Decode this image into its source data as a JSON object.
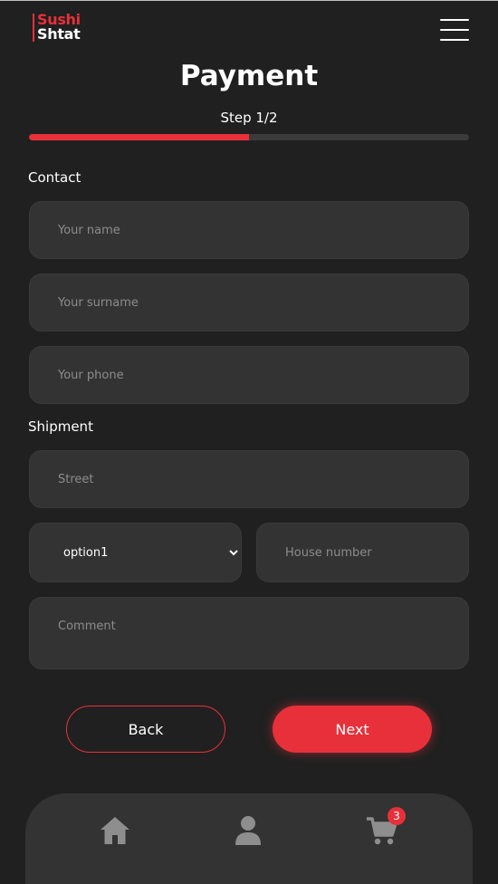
{
  "header": {
    "logo_line1": "Sushi",
    "logo_line2": "Shtat",
    "menu_icon": "hamburger-menu-icon"
  },
  "page": {
    "title": "Payment",
    "step_label": "Step 1/2",
    "progress_fraction": 0.5
  },
  "contact": {
    "section_title": "Contact",
    "name_placeholder": "Your name",
    "surname_placeholder": "Your surname",
    "phone_placeholder": "Your phone"
  },
  "shipment": {
    "section_title": "Shipment",
    "street_placeholder": "Street",
    "select_value": "option1",
    "house_placeholder": "House number",
    "comment_placeholder": "Comment"
  },
  "actions": {
    "back_label": "Back",
    "next_label": "Next"
  },
  "bottom_nav": {
    "home_icon": "home-icon",
    "user_icon": "user-icon",
    "cart_icon": "cart-icon",
    "cart_count": "3"
  },
  "colors": {
    "accent": "#e8303a",
    "background": "#202020",
    "field": "#333333"
  }
}
